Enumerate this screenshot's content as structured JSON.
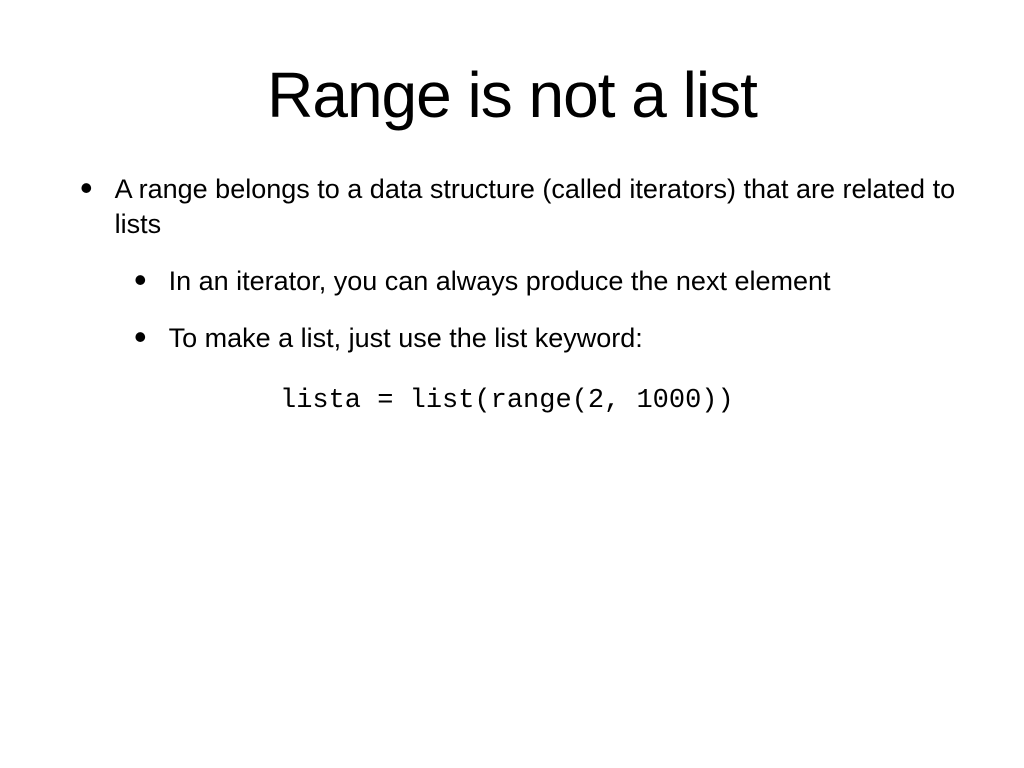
{
  "slide": {
    "title": "Range is not a list",
    "bullets": [
      {
        "level": 1,
        "text": "A range belongs to a data structure (called iterators) that are related to lists"
      },
      {
        "level": 2,
        "text": "In an iterator, you can always produce the next element"
      },
      {
        "level": 2,
        "text": "To make a list, just use the list keyword:"
      }
    ],
    "code": "lista = list(range(2, 1000))"
  }
}
